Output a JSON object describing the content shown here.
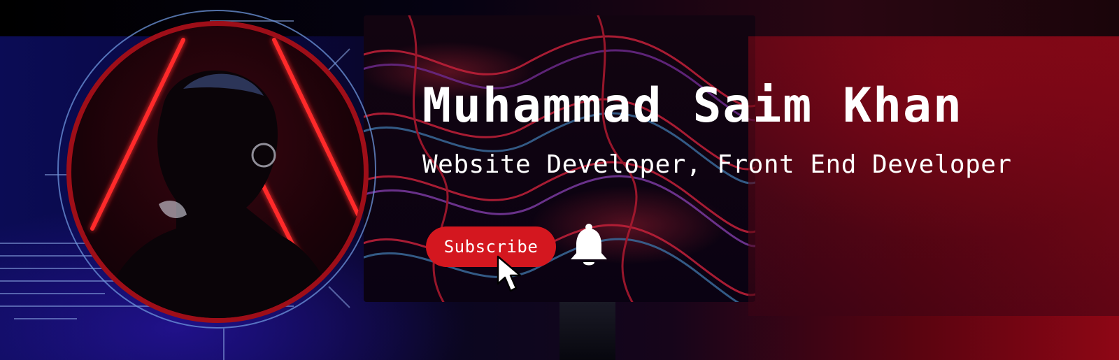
{
  "banner": {
    "name": "Muhammad Saim Khan",
    "subtitle": "Website Developer, Front End Developer",
    "subscribe_label": "Subscribe"
  },
  "icons": {
    "cursor": "mouse-pointer-icon",
    "bell": "bell-icon"
  },
  "colors": {
    "accent_red": "#d4171f",
    "ring_red": "#9e0e18",
    "ring_blue": "#6e96dc",
    "text": "#ffffff"
  }
}
